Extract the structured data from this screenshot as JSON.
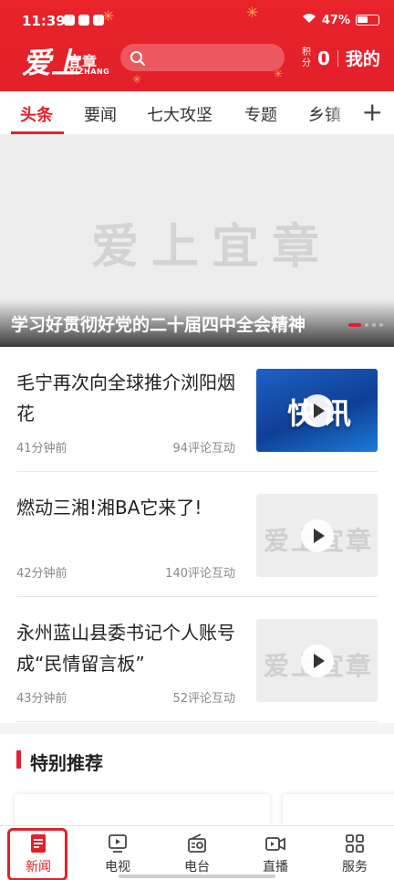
{
  "status_bar": {
    "time": "11:39",
    "battery": "47%"
  },
  "header": {
    "logo_main": "爱上",
    "logo_small": "宜章",
    "logo_en": "YIZHANG",
    "points_label": "积分",
    "points_value": "0",
    "mine_label": "我的"
  },
  "tabs": [
    "头条",
    "要闻",
    "七大攻坚",
    "专题",
    "乡镇"
  ],
  "tab_plus": "+",
  "banner": {
    "watermark": "爱上宜章",
    "title": "学习好贯彻好党的二十届四中全会精神"
  },
  "news": [
    {
      "headline": "毛宁再次向全球推介浏阳烟花",
      "time": "41分钟前",
      "comments": "94评论互动",
      "thumb_text": "快讯"
    },
    {
      "headline": "燃动三湘!湘BA它来了!",
      "time": "42分钟前",
      "comments": "140评论互动",
      "thumb_text": ""
    },
    {
      "headline": "永州蓝山县委书记个人账号成“民情留言板”",
      "time": "43分钟前",
      "comments": "52评论互动",
      "thumb_text": ""
    }
  ],
  "special": {
    "title": "特别推荐"
  },
  "bottom_nav": [
    {
      "label": "新闻",
      "icon": "news-icon"
    },
    {
      "label": "电视",
      "icon": "tv-icon"
    },
    {
      "label": "电台",
      "icon": "radio-icon"
    },
    {
      "label": "直播",
      "icon": "live-icon"
    },
    {
      "label": "服务",
      "icon": "grid-icon"
    }
  ],
  "colors": {
    "brand_red": "#e3202a"
  }
}
